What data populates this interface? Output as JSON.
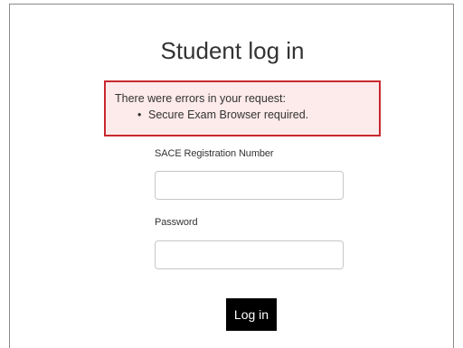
{
  "login": {
    "title": "Student log in",
    "error": {
      "heading": "There were errors in your request:",
      "items": [
        {
          "bullet": "•",
          "text": "Secure Exam Browser required."
        }
      ]
    },
    "fields": {
      "registration": {
        "label": "SACE Registration Number",
        "value": "",
        "placeholder": ""
      },
      "password": {
        "label": "Password",
        "value": "",
        "placeholder": ""
      }
    },
    "submit_label": "Log in"
  },
  "colors": {
    "error_border": "#c8282e",
    "error_background": "#fdeaea",
    "button_background": "#000000",
    "button_text": "#ffffff"
  }
}
